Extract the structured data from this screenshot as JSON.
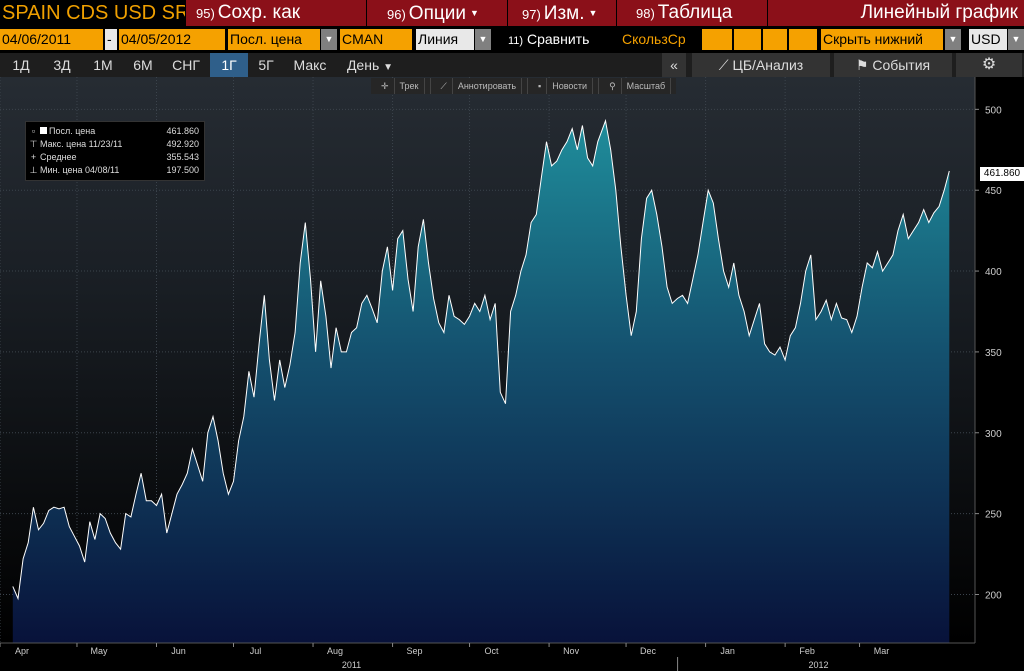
{
  "header": {
    "title": "SPAIN CDS USD SR",
    "save_num": "95)",
    "save_label": "Сохр. как",
    "options_num": "96)",
    "options_label": "Опции",
    "edit_num": "97)",
    "edit_label": "Изм.",
    "table_num": "98)",
    "table_label": "Таблица",
    "chart_type_title": "Линейный график"
  },
  "settings": {
    "start_date": "04/06/2011",
    "dash": "-",
    "end_date": "04/05/2012",
    "price_field": "Посл. цена",
    "source": "CMAN",
    "line_style": "Линия",
    "compare_num": "11)",
    "compare_label": "Сравнить",
    "moving_avg": "СкользСр",
    "hide_lower": "Скрыть нижний",
    "currency": "USD"
  },
  "periods": [
    "1Д",
    "3Д",
    "1М",
    "6М",
    "СНГ",
    "1Г",
    "5Г",
    "Макс"
  ],
  "active_period": "1Г",
  "frequency": "День",
  "collapse_glyph": "«",
  "analysis_label": "ЦБ/Анализ",
  "events_label": "События",
  "toolbar": {
    "track": "Трек",
    "annotate": "Аннотировать",
    "news": "Новости",
    "zoom": "Масштаб"
  },
  "legend": {
    "last_label": "Посл. цена",
    "last_value": "461.860",
    "high_label": "Макс. цена 11/23/11",
    "high_value": "492.920",
    "avg_label": "Среднее",
    "avg_value": "355.543",
    "low_label": "Мин. цена 04/08/11",
    "low_value": "197.500"
  },
  "last_price_tag": "461.860",
  "colors": {
    "accent_orange": "#f5a100",
    "title_orange": "#f0a000",
    "menu_red": "#8b1019",
    "active_period": "#2f5f8a",
    "area_top": "#1d8a99",
    "area_bottom": "#0a1540",
    "line": "#ffffff"
  },
  "chart_data": {
    "type": "area",
    "title": "",
    "ylim": [
      170,
      520
    ],
    "yticks": [
      200,
      250,
      300,
      350,
      400,
      450,
      500
    ],
    "xlim": [
      "2011-04-01",
      "2012-04-15"
    ],
    "month_ticks": [
      {
        "label": "Apr",
        "date": "2011-04-01"
      },
      {
        "label": "May",
        "date": "2011-05-01"
      },
      {
        "label": "Jun",
        "date": "2011-06-01"
      },
      {
        "label": "Jul",
        "date": "2011-07-01"
      },
      {
        "label": "Aug",
        "date": "2011-08-01"
      },
      {
        "label": "Sep",
        "date": "2011-09-01"
      },
      {
        "label": "Oct",
        "date": "2011-10-01"
      },
      {
        "label": "Nov",
        "date": "2011-11-01"
      },
      {
        "label": "Dec",
        "date": "2011-12-01"
      },
      {
        "label": "Jan",
        "date": "2012-01-01"
      },
      {
        "label": "Feb",
        "date": "2012-02-01"
      },
      {
        "label": "Mar",
        "date": "2012-03-01"
      }
    ],
    "year_labels": [
      {
        "label": "2011",
        "date": "2011-08-16"
      },
      {
        "label": "2012",
        "date": "2012-02-14"
      }
    ],
    "year_separator": "2012-01-01",
    "grid": true,
    "series": [
      {
        "points": [
          [
            "2011-04-06",
            205
          ],
          [
            "2011-04-08",
            197.5
          ],
          [
            "2011-04-10",
            222
          ],
          [
            "2011-04-12",
            232
          ],
          [
            "2011-04-14",
            254
          ],
          [
            "2011-04-16",
            240
          ],
          [
            "2011-04-18",
            244
          ],
          [
            "2011-04-20",
            252
          ],
          [
            "2011-04-22",
            254
          ],
          [
            "2011-04-24",
            253
          ],
          [
            "2011-04-26",
            254
          ],
          [
            "2011-04-28",
            242
          ],
          [
            "2011-04-30",
            236
          ],
          [
            "2011-05-02",
            230
          ],
          [
            "2011-05-04",
            220
          ],
          [
            "2011-05-06",
            245
          ],
          [
            "2011-05-08",
            234
          ],
          [
            "2011-05-10",
            250
          ],
          [
            "2011-05-12",
            247
          ],
          [
            "2011-05-14",
            238
          ],
          [
            "2011-05-16",
            232
          ],
          [
            "2011-05-18",
            228
          ],
          [
            "2011-05-20",
            250
          ],
          [
            "2011-05-22",
            248
          ],
          [
            "2011-05-24",
            262
          ],
          [
            "2011-05-26",
            275
          ],
          [
            "2011-05-28",
            258
          ],
          [
            "2011-05-30",
            258
          ],
          [
            "2011-06-01",
            255
          ],
          [
            "2011-06-03",
            262
          ],
          [
            "2011-06-05",
            238
          ],
          [
            "2011-06-07",
            250
          ],
          [
            "2011-06-09",
            262
          ],
          [
            "2011-06-11",
            268
          ],
          [
            "2011-06-13",
            275
          ],
          [
            "2011-06-15",
            290
          ],
          [
            "2011-06-17",
            280
          ],
          [
            "2011-06-19",
            270
          ],
          [
            "2011-06-21",
            300
          ],
          [
            "2011-06-23",
            310
          ],
          [
            "2011-06-25",
            295
          ],
          [
            "2011-06-27",
            275
          ],
          [
            "2011-06-29",
            262
          ],
          [
            "2011-07-01",
            270
          ],
          [
            "2011-07-03",
            295
          ],
          [
            "2011-07-05",
            310
          ],
          [
            "2011-07-07",
            338
          ],
          [
            "2011-07-09",
            322
          ],
          [
            "2011-07-11",
            355
          ],
          [
            "2011-07-13",
            385
          ],
          [
            "2011-07-15",
            345
          ],
          [
            "2011-07-17",
            320
          ],
          [
            "2011-07-19",
            345
          ],
          [
            "2011-07-21",
            328
          ],
          [
            "2011-07-23",
            342
          ],
          [
            "2011-07-25",
            362
          ],
          [
            "2011-07-27",
            405
          ],
          [
            "2011-07-29",
            430
          ],
          [
            "2011-07-31",
            395
          ],
          [
            "2011-08-02",
            350
          ],
          [
            "2011-08-04",
            394
          ],
          [
            "2011-08-06",
            372
          ],
          [
            "2011-08-08",
            340
          ],
          [
            "2011-08-10",
            365
          ],
          [
            "2011-08-12",
            350
          ],
          [
            "2011-08-14",
            350
          ],
          [
            "2011-08-16",
            362
          ],
          [
            "2011-08-18",
            365
          ],
          [
            "2011-08-20",
            380
          ],
          [
            "2011-08-22",
            385
          ],
          [
            "2011-08-24",
            377
          ],
          [
            "2011-08-26",
            368
          ],
          [
            "2011-08-28",
            400
          ],
          [
            "2011-08-30",
            415
          ],
          [
            "2011-09-01",
            388
          ],
          [
            "2011-09-03",
            420
          ],
          [
            "2011-09-05",
            425
          ],
          [
            "2011-09-07",
            395
          ],
          [
            "2011-09-09",
            375
          ],
          [
            "2011-09-11",
            415
          ],
          [
            "2011-09-13",
            432
          ],
          [
            "2011-09-15",
            405
          ],
          [
            "2011-09-17",
            383
          ],
          [
            "2011-09-19",
            368
          ],
          [
            "2011-09-21",
            362
          ],
          [
            "2011-09-23",
            385
          ],
          [
            "2011-09-25",
            372
          ],
          [
            "2011-09-27",
            370
          ],
          [
            "2011-09-29",
            367
          ],
          [
            "2011-10-01",
            372
          ],
          [
            "2011-10-03",
            380
          ],
          [
            "2011-10-05",
            375
          ],
          [
            "2011-10-07",
            385
          ],
          [
            "2011-10-09",
            370
          ],
          [
            "2011-10-11",
            380
          ],
          [
            "2011-10-13",
            325
          ],
          [
            "2011-10-15",
            318
          ],
          [
            "2011-10-17",
            375
          ],
          [
            "2011-10-19",
            385
          ],
          [
            "2011-10-21",
            400
          ],
          [
            "2011-10-23",
            410
          ],
          [
            "2011-10-25",
            430
          ],
          [
            "2011-10-27",
            435
          ],
          [
            "2011-10-29",
            458
          ],
          [
            "2011-10-31",
            480
          ],
          [
            "2011-11-02",
            465
          ],
          [
            "2011-11-04",
            468
          ],
          [
            "2011-11-06",
            475
          ],
          [
            "2011-11-08",
            480
          ],
          [
            "2011-11-10",
            488
          ],
          [
            "2011-11-12",
            475
          ],
          [
            "2011-11-14",
            490
          ],
          [
            "2011-11-16",
            470
          ],
          [
            "2011-11-18",
            465
          ],
          [
            "2011-11-20",
            480
          ],
          [
            "2011-11-23",
            492.92
          ],
          [
            "2011-11-25",
            475
          ],
          [
            "2011-11-27",
            450
          ],
          [
            "2011-11-29",
            415
          ],
          [
            "2011-12-01",
            385
          ],
          [
            "2011-12-03",
            360
          ],
          [
            "2011-12-05",
            375
          ],
          [
            "2011-12-07",
            420
          ],
          [
            "2011-12-09",
            445
          ],
          [
            "2011-12-11",
            450
          ],
          [
            "2011-12-13",
            435
          ],
          [
            "2011-12-15",
            415
          ],
          [
            "2011-12-17",
            390
          ],
          [
            "2011-12-19",
            380
          ],
          [
            "2011-12-21",
            383
          ],
          [
            "2011-12-23",
            385
          ],
          [
            "2011-12-25",
            380
          ],
          [
            "2011-12-27",
            395
          ],
          [
            "2011-12-29",
            410
          ],
          [
            "2011-12-31",
            430
          ],
          [
            "2012-01-02",
            450
          ],
          [
            "2012-01-04",
            442
          ],
          [
            "2012-01-06",
            420
          ],
          [
            "2012-01-08",
            400
          ],
          [
            "2012-01-10",
            390
          ],
          [
            "2012-01-12",
            405
          ],
          [
            "2012-01-14",
            385
          ],
          [
            "2012-01-16",
            375
          ],
          [
            "2012-01-18",
            360
          ],
          [
            "2012-01-20",
            370
          ],
          [
            "2012-01-22",
            380
          ],
          [
            "2012-01-24",
            355
          ],
          [
            "2012-01-26",
            350
          ],
          [
            "2012-01-28",
            348
          ],
          [
            "2012-01-30",
            353
          ],
          [
            "2012-02-01",
            345
          ],
          [
            "2012-02-03",
            360
          ],
          [
            "2012-02-05",
            365
          ],
          [
            "2012-02-07",
            380
          ],
          [
            "2012-02-09",
            400
          ],
          [
            "2012-02-11",
            410
          ],
          [
            "2012-02-13",
            370
          ],
          [
            "2012-02-15",
            375
          ],
          [
            "2012-02-17",
            382
          ],
          [
            "2012-02-19",
            370
          ],
          [
            "2012-02-21",
            380
          ],
          [
            "2012-02-23",
            371
          ],
          [
            "2012-02-25",
            370
          ],
          [
            "2012-02-27",
            362
          ],
          [
            "2012-02-29",
            372
          ],
          [
            "2012-03-02",
            390
          ],
          [
            "2012-03-04",
            405
          ],
          [
            "2012-03-06",
            402
          ],
          [
            "2012-03-08",
            412
          ],
          [
            "2012-03-10",
            400
          ],
          [
            "2012-03-12",
            405
          ],
          [
            "2012-03-14",
            410
          ],
          [
            "2012-03-16",
            425
          ],
          [
            "2012-03-18",
            435
          ],
          [
            "2012-03-20",
            420
          ],
          [
            "2012-03-22",
            425
          ],
          [
            "2012-03-24",
            430
          ],
          [
            "2012-03-26",
            438
          ],
          [
            "2012-03-28",
            430
          ],
          [
            "2012-03-30",
            436
          ],
          [
            "2012-04-01",
            440
          ],
          [
            "2012-04-03",
            450
          ],
          [
            "2012-04-05",
            461.86
          ]
        ]
      }
    ]
  }
}
